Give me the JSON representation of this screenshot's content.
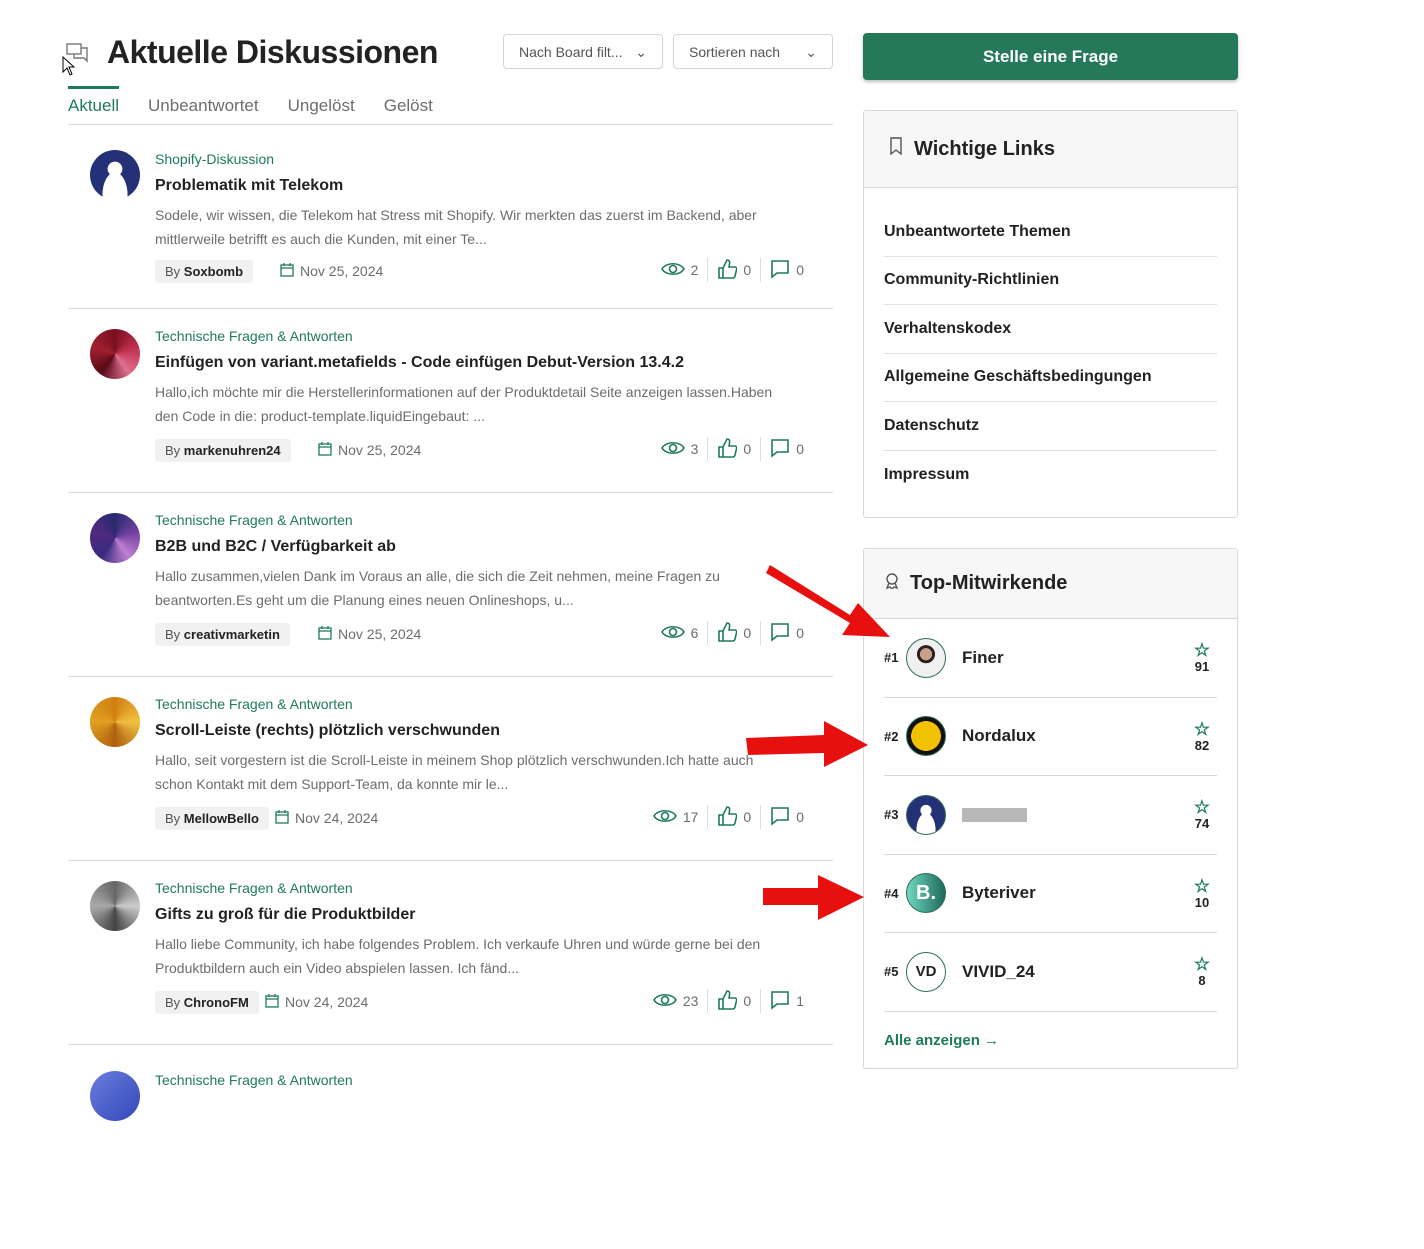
{
  "header": {
    "title": "Aktuelle Diskussionen",
    "board_filter": "Nach Board filt...",
    "sort": "Sortieren nach"
  },
  "tabs": [
    "Aktuell",
    "Unbeantwortet",
    "Ungelöst",
    "Gelöst"
  ],
  "posts": [
    {
      "board": "Shopify-Diskussion",
      "title": "Problematik mit Telekom",
      "excerpt": "Sodele, wir wissen, die Telekom hat Stress mit Shopify. Wir merkten das zuerst im Backend, aber mittlerweile betrifft es auch die Kunden, mit einer Te...",
      "by": "By",
      "author": "Soxbomb",
      "date": "Nov 25, 2024",
      "views": "2",
      "likes": "0",
      "replies": "0"
    },
    {
      "board": "Technische Fragen & Antworten",
      "title": "Einfügen von variant.metafields - Code einfügen Debut-Version 13.4.2",
      "excerpt": "Hallo,ich möchte mir die Herstellerinformationen auf der Produktdetail Seite anzeigen lassen.Haben den Code in die: product-template.liquidEingebaut: ...",
      "by": "By",
      "author": "markenuhren24",
      "date": "Nov 25, 2024",
      "views": "3",
      "likes": "0",
      "replies": "0"
    },
    {
      "board": "Technische Fragen & Antworten",
      "title": "B2B und B2C / Verfügbarkeit ab",
      "excerpt": "Hallo zusammen,vielen Dank im Voraus an alle, die sich die Zeit nehmen, meine Fragen zu beantworten.Es geht um die Planung eines neuen Onlineshops, u...",
      "by": "By",
      "author": "creativmarketin",
      "date": "Nov 25, 2024",
      "views": "6",
      "likes": "0",
      "replies": "0"
    },
    {
      "board": "Technische Fragen & Antworten",
      "title": "Scroll-Leiste (rechts) plötzlich verschwunden",
      "excerpt": "Hallo, seit vorgestern ist die Scroll-Leiste in meinem Shop plötzlich verschwunden.Ich hatte auch schon Kontakt mit dem Support-Team, da konnte mir le...",
      "by": "By",
      "author": "MellowBello",
      "date": "Nov 24, 2024",
      "views": "17",
      "likes": "0",
      "replies": "0"
    },
    {
      "board": "Technische Fragen & Antworten",
      "title": "Gifts zu groß für die Produktbilder",
      "excerpt": "Hallo liebe Community, ich habe folgendes Problem. Ich verkaufe Uhren und würde gerne bei den Produktbildern auch ein Video abspielen lassen. Ich fänd...",
      "by": "By",
      "author": "ChronoFM",
      "date": "Nov 24, 2024",
      "views": "23",
      "likes": "0",
      "replies": "1"
    },
    {
      "board": "Technische Fragen & Antworten"
    }
  ],
  "sidebar": {
    "ask_button": "Stelle eine Frage",
    "links_title": "Wichtige Links",
    "links": [
      "Unbeantwortete Themen",
      "Community-Richtlinien",
      "Verhaltenskodex",
      "Allgemeine Geschäftsbedingungen",
      "Datenschutz",
      "Impressum"
    ],
    "contrib_title": "Top-Mitwirkende",
    "contributors": [
      {
        "rank": "#1",
        "name": "Finer",
        "score": "91"
      },
      {
        "rank": "#2",
        "name": "Nordalux",
        "score": "82"
      },
      {
        "rank": "#3",
        "name": "",
        "score": "74"
      },
      {
        "rank": "#4",
        "name": "Byteriver",
        "score": "10"
      },
      {
        "rank": "#5",
        "name": "VIVID_24",
        "score": "8"
      }
    ],
    "show_all": "Alle anzeigen →"
  },
  "colors": {
    "accent": "#1e7b5a",
    "annotation": "#e8100f"
  }
}
